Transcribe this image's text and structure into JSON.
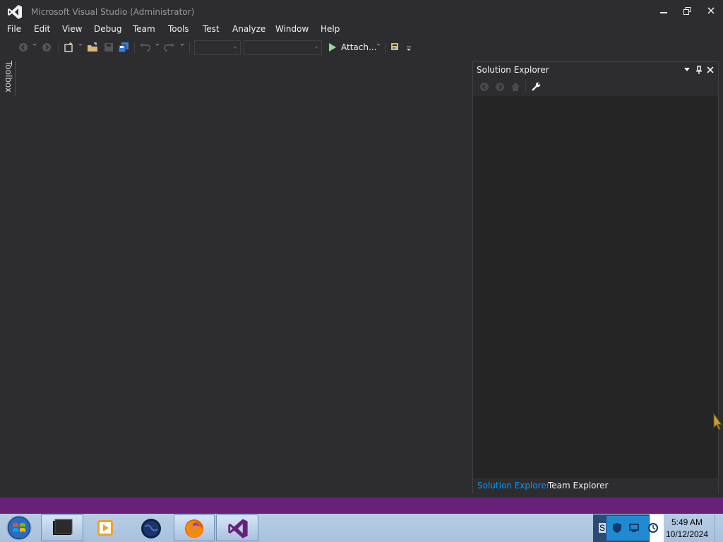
{
  "window": {
    "title": "Microsoft Visual Studio (Administrator)"
  },
  "menu": {
    "items": [
      "File",
      "Edit",
      "View",
      "Debug",
      "Team",
      "Tools",
      "Test",
      "Analyze",
      "Window",
      "Help"
    ]
  },
  "toolbar": {
    "attach_label": "Attach..."
  },
  "toolbox": {
    "label": "Toolbox"
  },
  "solution_explorer": {
    "title": "Solution Explorer",
    "tabs": [
      {
        "label": "Solution Explorer",
        "active": true
      },
      {
        "label": "Team Explorer",
        "active": false
      }
    ]
  },
  "taskbar": {
    "clock_time": "5:49 AM",
    "clock_date": "10/12/2024",
    "tray_letter": "S"
  },
  "colors": {
    "background": "#2d2d30",
    "status_bar": "#68217a",
    "active_tab": "#0097fb",
    "play": "#8ae28a"
  },
  "icons": [
    "vs-logo-icon",
    "minimize-icon",
    "restore-icon",
    "close-icon",
    "back-icon",
    "forward-icon",
    "new-project-icon",
    "open-file-icon",
    "save-icon",
    "save-all-icon",
    "undo-icon",
    "redo-icon",
    "play-icon",
    "find-icon",
    "pin-icon",
    "wrench-icon",
    "home-icon",
    "start-orb-icon",
    "firefox-icon"
  ]
}
